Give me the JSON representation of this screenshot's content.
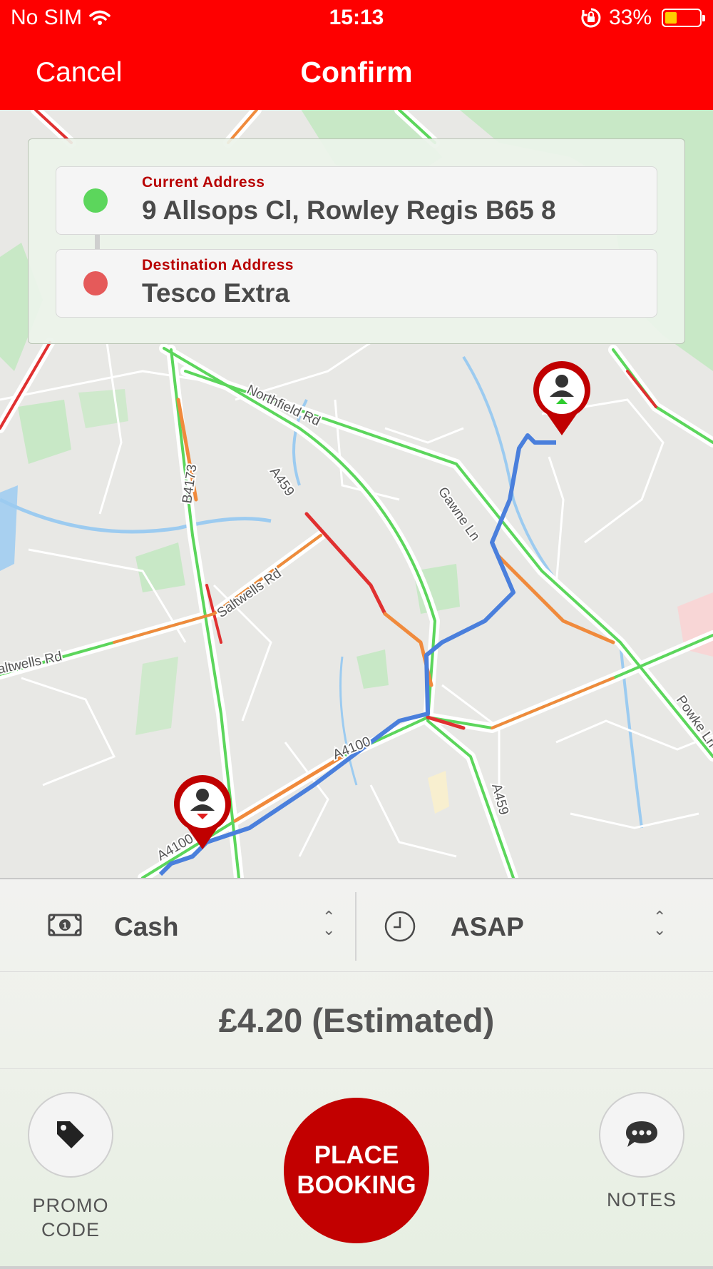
{
  "status_bar": {
    "carrier": "No SIM",
    "time": "15:13",
    "battery": "33%",
    "battery_level": 0.33
  },
  "nav": {
    "cancel_label": "Cancel",
    "title": "Confirm"
  },
  "addresses": {
    "pickup": {
      "label": "Current Address",
      "value": "9 Allsops Cl, Rowley Regis B65 8"
    },
    "destination": {
      "label": "Destination Address",
      "value": "Tesco Extra"
    }
  },
  "map": {
    "road_labels": [
      "Northfield Rd",
      "A459",
      "B4173",
      "Gawne Ln",
      "Saltwells Rd",
      "altwells Rd",
      "A4100",
      "A4100",
      "A459",
      "Powke Ln"
    ]
  },
  "booking": {
    "payment": {
      "icon": "cash-icon",
      "label": "Cash"
    },
    "time": {
      "icon": "clock-icon",
      "label": "ASAP"
    },
    "price": "£4.20 (Estimated)",
    "promo_label": "PROMO\nCODE",
    "notes_label": "NOTES",
    "place_booking_label": "PLACE\nBOOKING"
  },
  "colors": {
    "brand_red": "#fe0000",
    "button_red": "#c20000",
    "pickup_dot": "#5cd65c",
    "dest_dot": "#e55a5a",
    "route_blue": "#4a7fdc"
  }
}
